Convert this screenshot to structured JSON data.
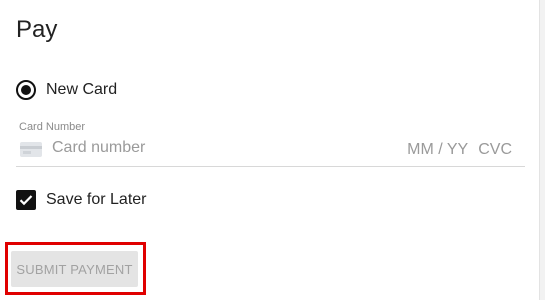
{
  "title": "Pay",
  "payment_method": {
    "option_label": "New Card",
    "selected": true
  },
  "card_field": {
    "label": "Card Number",
    "placeholder": "Card number",
    "expiry_placeholder": "MM / YY",
    "cvc_placeholder": "CVC",
    "icon": "credit-card-icon"
  },
  "save_for_later": {
    "label": "Save for Later",
    "checked": true
  },
  "submit": {
    "label": "SUBMIT PAYMENT",
    "disabled": true
  },
  "colors": {
    "highlight": "#e00000",
    "control": "#111111",
    "button_bg": "#e4e4e4",
    "button_text": "#a2a2a2"
  }
}
